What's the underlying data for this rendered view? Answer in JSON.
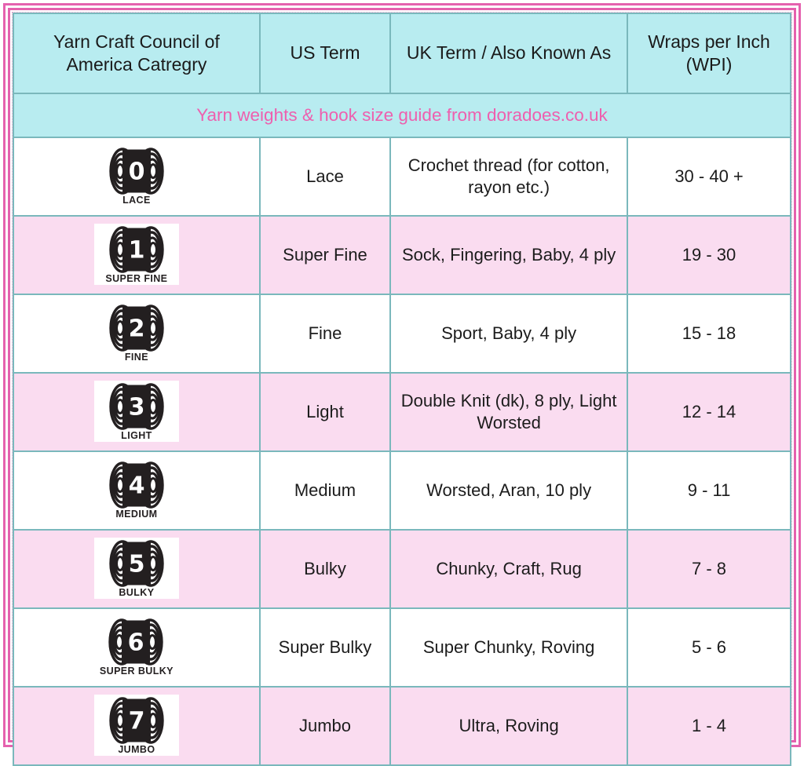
{
  "table": {
    "headers": [
      "Yarn Craft Council of America Catregry",
      "US Term",
      "UK Term / Also Known As",
      "Wraps per Inch (WPI)"
    ],
    "subtitle": "Yarn weights & hook size guide from doradoes.co.uk",
    "colors": {
      "header_background": "#b8ecf0",
      "subtitle_text": "#ee5fae",
      "row_alt_background": "#fadcf0",
      "row_background": "#ffffff",
      "gridline": "#7ab8bc",
      "outer_border": "#e561ae",
      "symbol_dark": "#231f20",
      "text": "#1c1c1c"
    },
    "rows": [
      {
        "symbol_number": "0",
        "symbol_label": "LACE",
        "us_term": "Lace",
        "uk_term": "Crochet thread (for cotton, rayon etc.)",
        "wpi": "30 - 40 +",
        "shade": "white"
      },
      {
        "symbol_number": "1",
        "symbol_label": "SUPER FINE",
        "us_term": "Super Fine",
        "uk_term": "Sock, Fingering, Baby, 4 ply",
        "wpi": "19 - 30",
        "shade": "pink"
      },
      {
        "symbol_number": "2",
        "symbol_label": "FINE",
        "us_term": "Fine",
        "uk_term": "Sport, Baby, 4 ply",
        "wpi": "15 - 18",
        "shade": "white"
      },
      {
        "symbol_number": "3",
        "symbol_label": "LIGHT",
        "us_term": "Light",
        "uk_term": "Double Knit (dk), 8 ply, Light Worsted",
        "wpi": "12 - 14",
        "shade": "pink"
      },
      {
        "symbol_number": "4",
        "symbol_label": "MEDIUM",
        "us_term": "Medium",
        "uk_term": "Worsted, Aran, 10 ply",
        "wpi": "9 - 11",
        "shade": "white"
      },
      {
        "symbol_number": "5",
        "symbol_label": "BULKY",
        "us_term": "Bulky",
        "uk_term": "Chunky, Craft, Rug",
        "wpi": "7 - 8",
        "shade": "pink"
      },
      {
        "symbol_number": "6",
        "symbol_label": "SUPER BULKY",
        "us_term": "Super Bulky",
        "uk_term": "Super Chunky, Roving",
        "wpi": "5 - 6",
        "shade": "white"
      },
      {
        "symbol_number": "7",
        "symbol_label": "JUMBO",
        "us_term": "Jumbo",
        "uk_term": "Ultra, Roving",
        "wpi": "1 - 4",
        "shade": "pink"
      }
    ]
  }
}
